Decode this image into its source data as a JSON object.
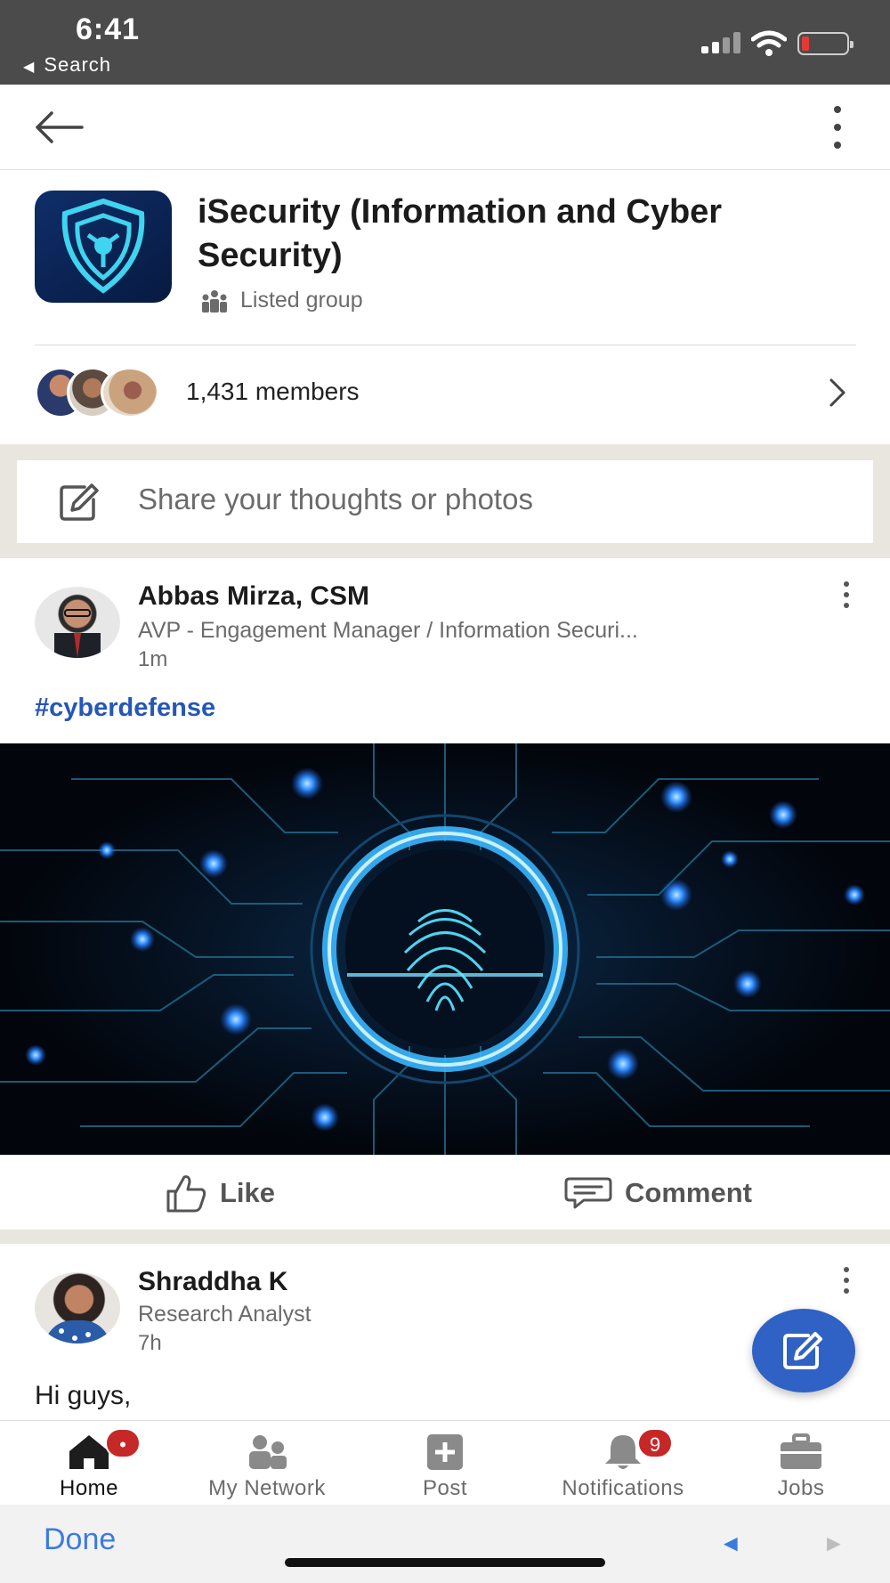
{
  "status_bar": {
    "time": "6:41",
    "back_app": "Search",
    "back_app_arrow": "◀"
  },
  "top_nav": {
    "back_icon": "arrow-left-icon",
    "more_icon": "more-vertical-icon"
  },
  "group": {
    "name": "iSecurity (Information and Cyber Security)",
    "type": "Listed group",
    "members_count": "1,431 members"
  },
  "share": {
    "placeholder": "Share your thoughts or photos"
  },
  "posts": [
    {
      "author": "Abbas Mirza, CSM",
      "title": "AVP - Engagement Manager / Information Securi...",
      "time": "1m",
      "hashtag": "#cyberdefense",
      "actions": {
        "like": "Like",
        "comment": "Comment"
      }
    },
    {
      "author": "Shraddha K",
      "title": "Research Analyst",
      "time": "7h",
      "text": "Hi guys,"
    }
  ],
  "tabs": [
    {
      "label": "Home",
      "icon": "home-icon",
      "active": true,
      "badge": "•"
    },
    {
      "label": "My Network",
      "icon": "network-icon"
    },
    {
      "label": "Post",
      "icon": "post-plus-icon"
    },
    {
      "label": "Notifications",
      "icon": "bell-icon",
      "badge": "9"
    },
    {
      "label": "Jobs",
      "icon": "briefcase-icon"
    }
  ],
  "browser": {
    "done": "Done",
    "prev": "◄",
    "next": "►"
  },
  "colors": {
    "accent": "#2f62c4",
    "hashtag": "#2557b8",
    "badge": "#c62828",
    "status_bar": "#4b4b4b",
    "separator": "#e9e6df"
  }
}
